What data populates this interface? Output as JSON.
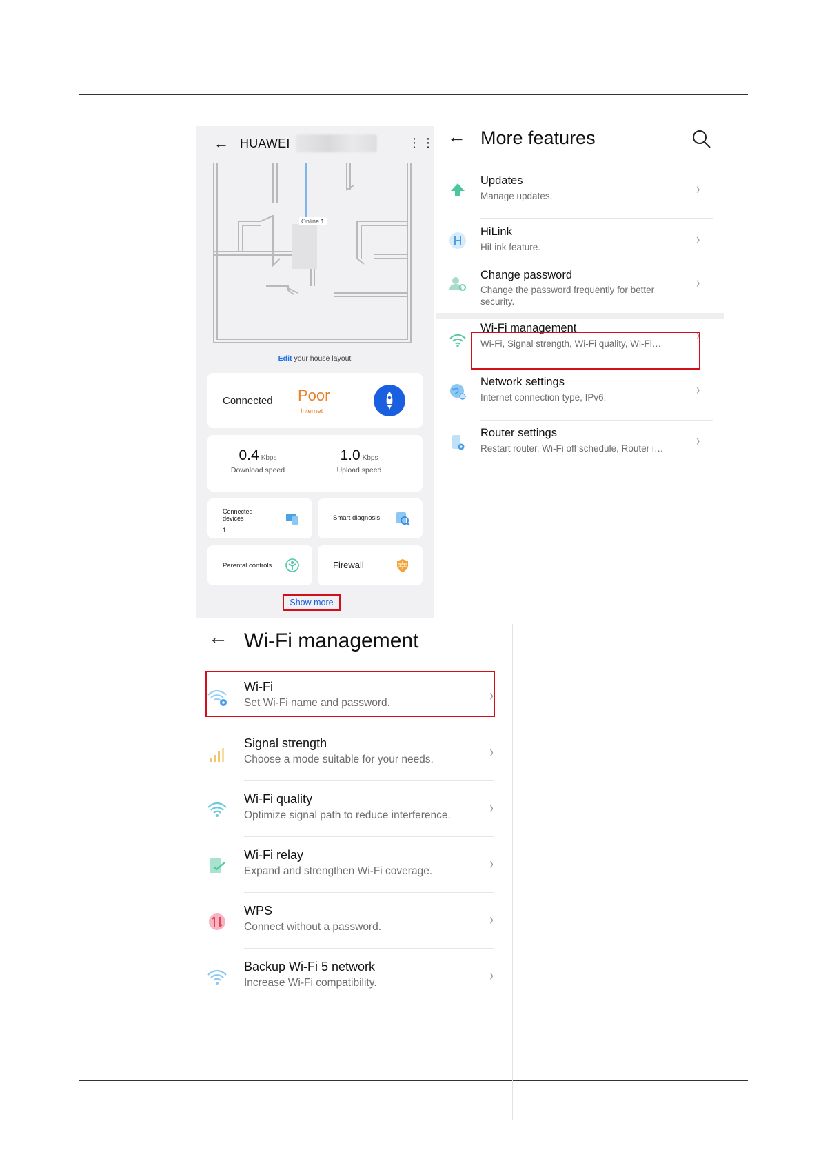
{
  "panel1": {
    "title": "HUAWEI",
    "floor_plan": {
      "online_label": "Online",
      "online_count": "1"
    },
    "edit_link": "Edit",
    "edit_suffix": "your house layout",
    "status": {
      "label": "Connected",
      "quality": "Poor",
      "quality_sub": "Internet"
    },
    "download": {
      "value": "0.4",
      "unit": "Kbps",
      "label": "Download speed"
    },
    "upload": {
      "value": "1.0",
      "unit": "Kbps",
      "label": "Upload speed"
    },
    "tiles": [
      {
        "label": "Connected devices",
        "value": "1",
        "icon": "devices-icon"
      },
      {
        "label": "Smart diagnosis",
        "icon": "diagnosis-icon"
      },
      {
        "label": "Parental controls",
        "icon": "parental-controls-icon"
      },
      {
        "label": "Firewall",
        "icon": "firewall-icon"
      }
    ],
    "show_more": "Show more"
  },
  "panel2": {
    "title": "More features",
    "items": [
      {
        "title": "Updates",
        "subtitle": "Manage updates.",
        "icon": "update-icon"
      },
      {
        "title": "HiLink",
        "subtitle": "HiLink feature.",
        "icon": "hilink-icon"
      },
      {
        "title": "Change password",
        "subtitle": "Change the password frequently for better security.",
        "icon": "password-icon"
      },
      {
        "title": "Wi-Fi management",
        "subtitle": "Wi-Fi, Signal strength, Wi-Fi quality, Wi-Fi…",
        "icon": "wifi-icon"
      },
      {
        "title": "Network settings",
        "subtitle": "Internet connection type, IPv6.",
        "icon": "globe-icon"
      },
      {
        "title": "Router settings",
        "subtitle": "Restart router, Wi-Fi off schedule, Router i…",
        "icon": "router-icon"
      }
    ]
  },
  "panel3": {
    "title": "Wi-Fi management",
    "items": [
      {
        "title": "Wi-Fi",
        "subtitle": "Set Wi-Fi name and password.",
        "icon": "wifi-settings-icon"
      },
      {
        "title": "Signal strength",
        "subtitle": "Choose a mode suitable for your needs.",
        "icon": "signal-icon"
      },
      {
        "title": "Wi-Fi quality",
        "subtitle": "Optimize signal path to reduce interference.",
        "icon": "wifi-quality-icon"
      },
      {
        "title": "Wi-Fi relay",
        "subtitle": "Expand and strengthen Wi-Fi coverage.",
        "icon": "relay-icon"
      },
      {
        "title": "WPS",
        "subtitle": "Connect without a password.",
        "icon": "wps-icon"
      },
      {
        "title": "Backup Wi-Fi 5 network",
        "subtitle": "Increase Wi-Fi compatibility.",
        "icon": "backup-wifi-icon"
      }
    ]
  },
  "colors": {
    "highlight": "#d20f1a",
    "accent_blue": "#1a5fe0",
    "warning_orange": "#e8822a"
  }
}
